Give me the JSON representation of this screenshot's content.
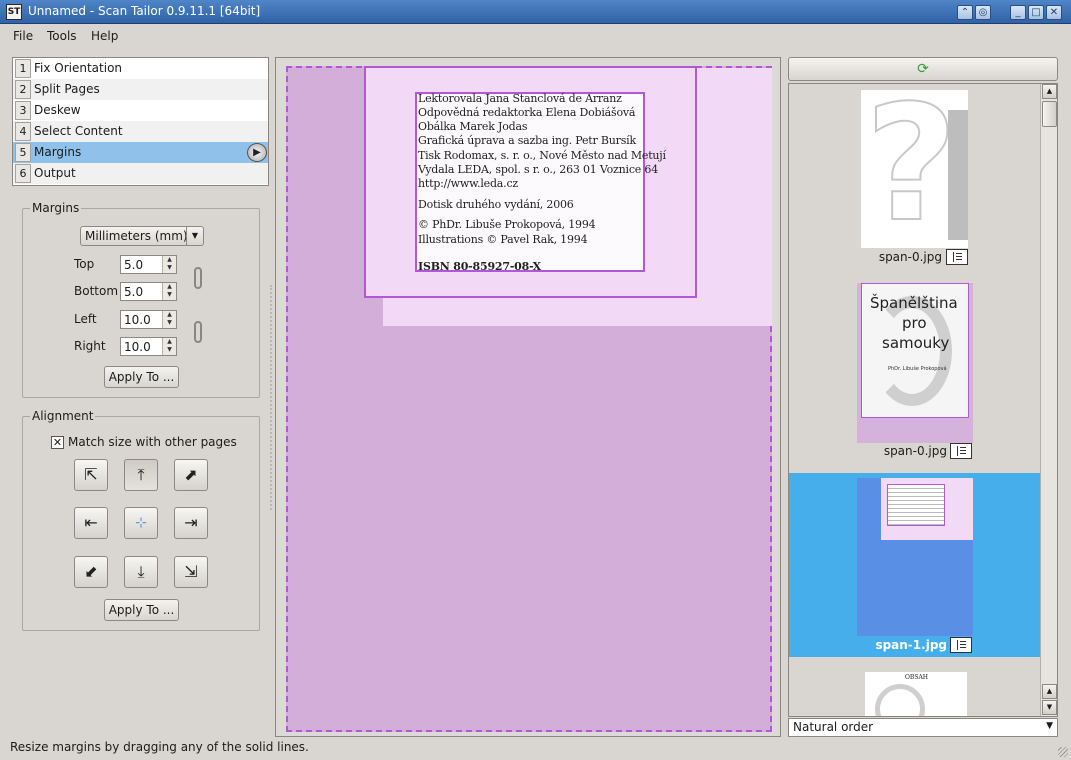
{
  "window": {
    "title": "Unnamed - Scan Tailor 0.9.11.1 [64bit]",
    "icon_text": "ST"
  },
  "menu": [
    "File",
    "Tools",
    "Help"
  ],
  "stages": [
    {
      "num": "1",
      "label": "Fix Orientation"
    },
    {
      "num": "2",
      "label": "Split Pages"
    },
    {
      "num": "3",
      "label": "Deskew"
    },
    {
      "num": "4",
      "label": "Select Content"
    },
    {
      "num": "5",
      "label": "Margins",
      "selected": true
    },
    {
      "num": "6",
      "label": "Output"
    }
  ],
  "margins": {
    "title": "Margins",
    "units": "Millimeters (mm)",
    "top_label": "Top",
    "top_value": "5.0",
    "bottom_label": "Bottom",
    "bottom_value": "5.0",
    "left_label": "Left",
    "left_value": "10.0",
    "right_label": "Right",
    "right_value": "10.0",
    "apply_label": "Apply To ..."
  },
  "alignment": {
    "title": "Alignment",
    "match_size_label": "Match size with other pages",
    "match_size_checked": true,
    "apply_label": "Apply To ...",
    "selected": "top-center"
  },
  "page_text": [
    "Lektorovala Jana Stanclová de Arranz",
    "Odpovědná redaktorka Elena Dobiášová",
    "Obálka Marek Jodas",
    "Grafická úprava a sazba ing. Petr Bursík",
    "Tisk Rodomax, s. r. o., Nové Město nad Metují",
    "Vydala LEDA, spol. s r. o., 263 01 Voznice 64",
    "http://www.leda.cz",
    "Dotisk druhého vydání, 2006",
    "© PhDr. Libuše Prokopová, 1994",
    "Illustrations © Pavel Rak, 1994",
    "ISBN 80-85927-08-X"
  ],
  "thumbnails": [
    {
      "caption": "span-0.jpg",
      "selected": false
    },
    {
      "caption": "span-0.jpg",
      "selected": false,
      "cover_title_1": "Španělština",
      "cover_title_2": "pro",
      "cover_title_3": "samouky",
      "cover_author": "PhDr. Libuše Prokopová"
    },
    {
      "caption": "span-1.jpg",
      "selected": true
    },
    {
      "caption": "",
      "selected": false,
      "partial_title": "OBSAH"
    }
  ],
  "sort_order": "Natural order",
  "status": "Resize margins by dragging any of the solid lines.",
  "colors": {
    "selection": "#46aeea",
    "margin_guide": "#b456d8",
    "page_fill": "#d2aed8"
  }
}
